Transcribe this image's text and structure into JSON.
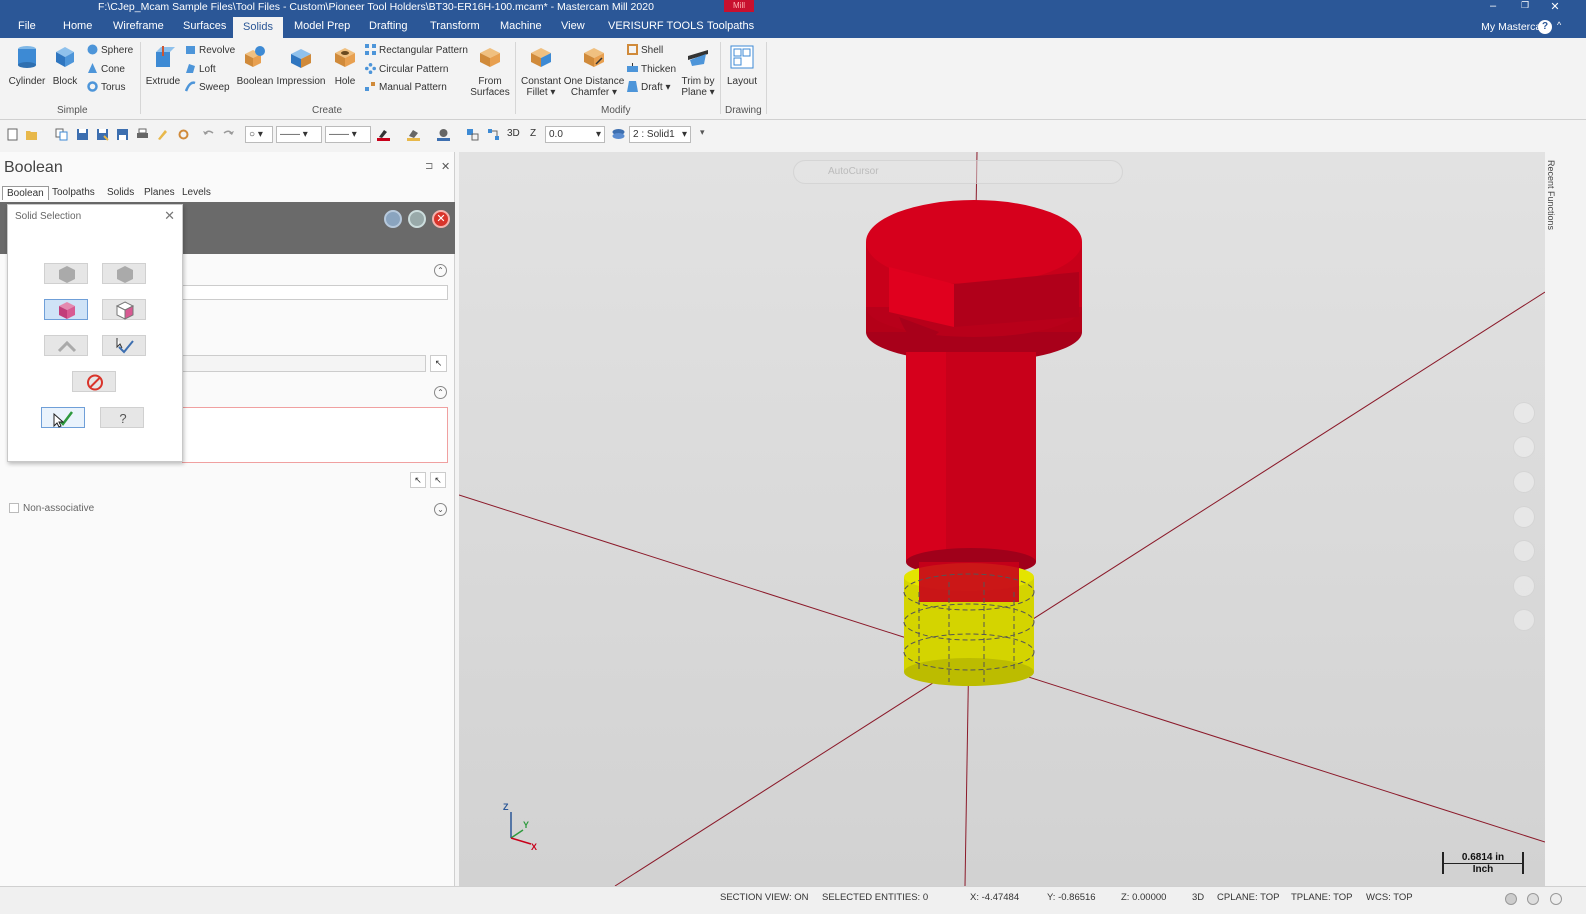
{
  "window": {
    "title": "F:\\CJep_Mcam Sample Files\\Tool Files - Custom\\Pioneer Tool Holders\\BT30-ER16H-100.mcam* - Mastercam Mill 2020",
    "product_badge": "Mill",
    "controls": [
      "–",
      "❐",
      "✕"
    ]
  },
  "menu": {
    "tabs": [
      "File",
      "Home",
      "Wireframe",
      "Surfaces",
      "Solids",
      "Model Prep",
      "Drafting",
      "Transform",
      "Machine",
      "View",
      "VERISURF TOOLS",
      "Toolpaths"
    ],
    "active": "Solids",
    "account": "My Mastercam",
    "help": "?"
  },
  "ribbon": {
    "simple": {
      "cylinder": "Cylinder",
      "block": "Block",
      "sphere": "Sphere",
      "cone": "Cone",
      "torus": "Torus",
      "label": "Simple"
    },
    "create": {
      "extrude": "Extrude",
      "revolve": "Revolve",
      "loft": "Loft",
      "sweep": "Sweep",
      "boolean": "Boolean",
      "impression": "Impression",
      "hole": "Hole",
      "rect_pattern": "Rectangular Pattern",
      "circ_pattern": "Circular Pattern",
      "manual_pattern": "Manual Pattern",
      "from_surfaces_1": "From",
      "from_surfaces_2": "Surfaces",
      "label": "Create"
    },
    "modify": {
      "fillet_1": "Constant",
      "fillet_2": "Fillet ▾",
      "chamfer_1": "One Distance",
      "chamfer_2": "Chamfer ▾",
      "shell": "Shell",
      "thicken": "Thicken",
      "draft": "Draft ▾",
      "trim_1": "Trim by",
      "trim_2": "Plane ▾",
      "label": "Modify"
    },
    "drawing": {
      "layout": "Layout",
      "label": "Drawing"
    }
  },
  "toolbar": {
    "mode_3d": "3D",
    "z_label": "Z",
    "z_value": "0.0",
    "level": "2 : Solid1"
  },
  "panel": {
    "title": "Boolean",
    "tabs": [
      "Boolean",
      "Toolpaths",
      "Solids",
      "Planes",
      "Levels"
    ],
    "active_tab": "Boolean",
    "non_associative": "Non-associative",
    "dialog": {
      "title": "Solid Selection"
    }
  },
  "viewport": {
    "autocursor": "AutoCursor",
    "scale_value": "0.6814 in",
    "scale_unit": "Inch",
    "axes": {
      "z": "Z",
      "y": "Y",
      "x": "X"
    },
    "recent_functions": "Recent Functions"
  },
  "status": {
    "section_view": "SECTION VIEW: ON",
    "selected": "SELECTED ENTITIES: 0",
    "x": "X:  -4.47484",
    "y": "Y:  -0.86516",
    "z": "Z:  0.00000",
    "mode": "3D",
    "cplane": "CPLANE: TOP",
    "tplane": "TPLANE: TOP",
    "wcs": "WCS: TOP"
  },
  "colors": {
    "title_blue": "#2b5797",
    "model_red": "#c8001a",
    "selected_yellow": "#d8d800",
    "axis_line": "#8b1a2a"
  }
}
